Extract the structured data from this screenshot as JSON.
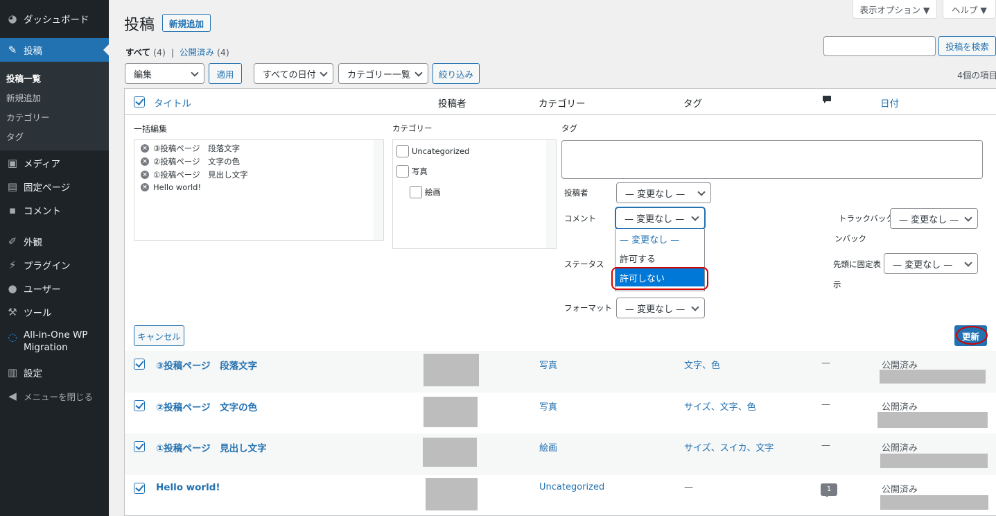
{
  "sidebar": {
    "dashboard": "ダッシュボード",
    "posts": "投稿",
    "submenu": [
      "投稿一覧",
      "新規追加",
      "カテゴリー",
      "タグ"
    ],
    "media": "メディア",
    "pages": "固定ページ",
    "comments": "コメント",
    "appearance": "外観",
    "plugins": "プラグイン",
    "users": "ユーザー",
    "tools": "ツール",
    "aiowpm": "All-in-One WP Migration",
    "settings": "設定",
    "collapse": "メニューを閉じる"
  },
  "header": {
    "title": "投稿",
    "add_new": "新規追加",
    "screen_options": "表示オプション ▼",
    "help": "ヘルプ ▼",
    "search_button": "投稿を検索",
    "search_value": "",
    "filter_all": "すべて",
    "filter_all_count": "(4)",
    "separator": "|",
    "filter_published": "公開済み",
    "filter_published_count": "(4)",
    "bulk_action": "編集",
    "apply": "適用",
    "date_filter": "すべての日付",
    "category_filter": "カテゴリー一覧",
    "filter_button": "絞り込み",
    "item_count": "4個の項目"
  },
  "table": {
    "columns": {
      "title": "タイトル",
      "author": "投稿者",
      "categories": "カテゴリー",
      "tags": "タグ",
      "date": "日付"
    }
  },
  "bulk_edit": {
    "heading": "一括編集",
    "titles": [
      "③投稿ページ　段落文字",
      "②投稿ページ　文字の色",
      "①投稿ページ　見出し文字",
      "Hello world!"
    ],
    "category_label": "カテゴリー",
    "categories": [
      "Uncategorized",
      "写真",
      "絵画"
    ],
    "tags_label": "タグ",
    "author_label": "投稿者",
    "author_value": "— 変更なし —",
    "comment_label": "コメント",
    "comment_value": "— 変更なし —",
    "comment_options": [
      "— 変更なし —",
      "許可する",
      "許可しない"
    ],
    "status_label": "ステータス",
    "format_label": "フォーマット",
    "format_value": "— 変更なし —",
    "pings_label_1": "トラックバック/ピ",
    "pings_label_2": "ンバック",
    "pings_value": "— 変更なし —",
    "sticky_label_1": "先頭に固定表",
    "sticky_label_2": "示",
    "sticky_value": "— 変更なし —",
    "cancel": "キャンセル",
    "update": "更新"
  },
  "posts": [
    {
      "title": "③投稿ページ　段落文字",
      "category": "写真",
      "tags": "文字、色",
      "comments": "—",
      "status": "公開済み"
    },
    {
      "title": "②投稿ページ　文字の色",
      "category": "写真",
      "tags": "サイズ、文字、色",
      "comments": "—",
      "status": "公開済み"
    },
    {
      "title": "①投稿ページ　見出し文字",
      "category": "絵画",
      "tags": "サイズ、スイカ、文字",
      "comments": "—",
      "status": "公開済み"
    },
    {
      "title": "Hello world!",
      "category": "Uncategorized",
      "tags": "—",
      "comments": "1",
      "status": "公開済み"
    }
  ]
}
